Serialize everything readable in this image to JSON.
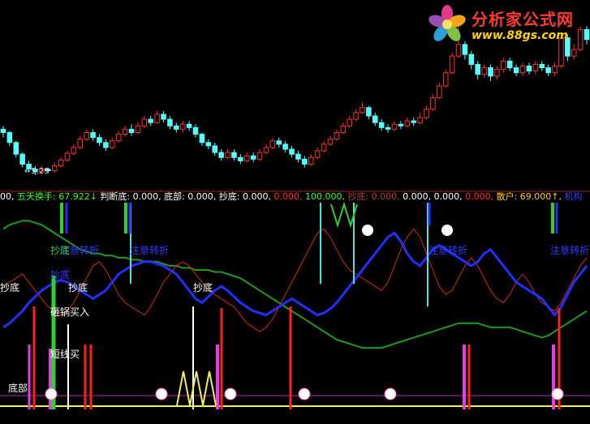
{
  "logo": {
    "title": "分析家公式网",
    "url": "www.88gs.com"
  },
  "price_marker": "←5.29",
  "status_bar": [
    {
      "text": "00,",
      "color": "#ffffff"
    },
    {
      "text": " 五天换手: 67.922↓",
      "color": "#33ff33"
    },
    {
      "text": " 判断底: 0.000,",
      "color": "#ffffff"
    },
    {
      "text": " 底部: 0.000,",
      "color": "#ffffff"
    },
    {
      "text": " 抄底: 0.000,",
      "color": "#ffffff"
    },
    {
      "text": " 0.000,",
      "color": "#ff3030"
    },
    {
      "text": " 100.000,",
      "color": "#33ff33"
    },
    {
      "text": " 抄底: 0.000,",
      "color": "#b04040"
    },
    {
      "text": " 0.000,",
      "color": "#ffffff"
    },
    {
      "text": " 0.000,",
      "color": "#ffffff"
    },
    {
      "text": " 0.000,",
      "color": "#ff3030"
    },
    {
      "text": " 散户: 69.000↑,",
      "color": "#ffd200"
    },
    {
      "text": " 机构",
      "color": "#3040ff"
    }
  ],
  "indicator_labels": [
    {
      "text": "抄底",
      "color": "white",
      "pos": "a"
    },
    {
      "text": "抄底",
      "color": "white",
      "pos": "b"
    },
    {
      "text": "抄底",
      "color": "white",
      "pos": "c"
    },
    {
      "text": "注意转折",
      "color": "blue",
      "pos": "d"
    },
    {
      "text": "注意转折",
      "color": "blue",
      "pos": "e"
    },
    {
      "text": "注意转折",
      "color": "blue",
      "pos": "f"
    },
    {
      "text": "注意转折",
      "color": "blue",
      "pos": "g"
    },
    {
      "text": "抄底",
      "color": "green",
      "pos": "h"
    },
    {
      "text": "抄底",
      "color": "blue",
      "pos": "i"
    },
    {
      "text": "砸锅买入",
      "color": "white",
      "pos": "j"
    },
    {
      "text": "短线买",
      "color": "white",
      "pos": "k"
    },
    {
      "text": "底部",
      "color": "white",
      "pos": "l"
    }
  ],
  "chart_data": {
    "type": "line",
    "candles": [
      [
        5.84,
        5.8,
        5.88,
        5.74
      ],
      [
        5.8,
        5.68,
        5.82,
        5.64
      ],
      [
        5.68,
        5.54,
        5.7,
        5.5
      ],
      [
        5.54,
        5.42,
        5.56,
        5.38
      ],
      [
        5.42,
        5.36,
        5.46,
        5.32
      ],
      [
        5.36,
        5.33,
        5.4,
        5.29
      ],
      [
        5.33,
        5.36,
        5.4,
        5.3
      ],
      [
        5.36,
        5.34,
        5.38,
        5.31
      ],
      [
        5.34,
        5.4,
        5.44,
        5.32
      ],
      [
        5.4,
        5.47,
        5.5,
        5.38
      ],
      [
        5.47,
        5.55,
        5.58,
        5.45
      ],
      [
        5.55,
        5.62,
        5.66,
        5.53
      ],
      [
        5.62,
        5.72,
        5.76,
        5.6
      ],
      [
        5.72,
        5.8,
        5.84,
        5.7
      ],
      [
        5.8,
        5.74,
        5.84,
        5.7
      ],
      [
        5.74,
        5.68,
        5.78,
        5.64
      ],
      [
        5.68,
        5.62,
        5.72,
        5.58
      ],
      [
        5.62,
        5.7,
        5.74,
        5.6
      ],
      [
        5.7,
        5.78,
        5.82,
        5.68
      ],
      [
        5.78,
        5.84,
        5.88,
        5.75
      ],
      [
        5.84,
        5.8,
        5.9,
        5.76
      ],
      [
        5.8,
        5.88,
        5.92,
        5.78
      ],
      [
        5.88,
        5.96,
        6.0,
        5.85
      ],
      [
        5.96,
        5.92,
        6.0,
        5.88
      ],
      [
        5.92,
        6.02,
        6.06,
        5.9
      ],
      [
        6.02,
        5.96,
        6.06,
        5.92
      ],
      [
        5.96,
        5.88,
        6.0,
        5.84
      ],
      [
        5.88,
        5.84,
        5.92,
        5.8
      ],
      [
        5.84,
        5.9,
        5.94,
        5.8
      ],
      [
        5.9,
        5.86,
        5.94,
        5.82
      ],
      [
        5.86,
        5.78,
        5.9,
        5.74
      ],
      [
        5.78,
        5.68,
        5.8,
        5.64
      ],
      [
        5.68,
        5.64,
        5.72,
        5.6
      ],
      [
        5.64,
        5.56,
        5.68,
        5.52
      ],
      [
        5.56,
        5.5,
        5.6,
        5.46
      ],
      [
        5.5,
        5.56,
        5.6,
        5.48
      ],
      [
        5.56,
        5.5,
        5.6,
        5.46
      ],
      [
        5.5,
        5.46,
        5.54,
        5.42
      ],
      [
        5.46,
        5.52,
        5.56,
        5.44
      ],
      [
        5.52,
        5.48,
        5.56,
        5.44
      ],
      [
        5.48,
        5.56,
        5.6,
        5.46
      ],
      [
        5.56,
        5.62,
        5.66,
        5.54
      ],
      [
        5.62,
        5.7,
        5.74,
        5.6
      ],
      [
        5.7,
        5.66,
        5.74,
        5.62
      ],
      [
        5.66,
        5.6,
        5.7,
        5.56
      ],
      [
        5.6,
        5.54,
        5.64,
        5.5
      ],
      [
        5.54,
        5.48,
        5.58,
        5.44
      ],
      [
        5.48,
        5.42,
        5.52,
        5.38
      ],
      [
        5.42,
        5.5,
        5.54,
        5.4
      ],
      [
        5.5,
        5.58,
        5.62,
        5.48
      ],
      [
        5.58,
        5.66,
        5.7,
        5.56
      ],
      [
        5.66,
        5.72,
        5.76,
        5.64
      ],
      [
        5.72,
        5.8,
        5.84,
        5.7
      ],
      [
        5.8,
        5.88,
        5.92,
        5.78
      ],
      [
        5.88,
        5.96,
        6.0,
        5.86
      ],
      [
        5.96,
        6.04,
        6.08,
        5.94
      ],
      [
        6.04,
        6.1,
        6.16,
        6.02
      ],
      [
        6.1,
        6.0,
        6.12,
        5.96
      ],
      [
        6.0,
        5.92,
        6.04,
        5.88
      ],
      [
        5.92,
        5.86,
        5.96,
        5.82
      ],
      [
        5.86,
        5.84,
        5.9,
        5.8
      ],
      [
        5.84,
        5.9,
        5.94,
        5.82
      ],
      [
        5.9,
        5.88,
        5.94,
        5.84
      ],
      [
        5.88,
        5.94,
        5.98,
        5.86
      ],
      [
        5.94,
        5.92,
        5.98,
        5.88
      ],
      [
        5.92,
        5.98,
        6.04,
        5.9
      ],
      [
        5.98,
        6.08,
        6.12,
        5.96
      ],
      [
        6.08,
        6.22,
        6.26,
        6.06
      ],
      [
        6.22,
        6.36,
        6.4,
        6.2
      ],
      [
        6.36,
        6.52,
        6.56,
        6.34
      ],
      [
        6.52,
        6.72,
        6.76,
        6.5
      ],
      [
        6.72,
        6.86,
        7.1,
        6.7
      ],
      [
        6.86,
        6.74,
        6.9,
        6.68
      ],
      [
        6.74,
        6.62,
        6.78,
        6.56
      ],
      [
        6.62,
        6.5,
        6.66,
        6.44
      ],
      [
        6.5,
        6.58,
        6.62,
        6.46
      ],
      [
        6.58,
        6.48,
        6.62,
        6.42
      ],
      [
        6.48,
        6.56,
        6.6,
        6.44
      ],
      [
        6.56,
        6.66,
        6.7,
        6.52
      ],
      [
        6.66,
        6.58,
        6.7,
        6.54
      ],
      [
        6.58,
        6.52,
        6.62,
        6.48
      ],
      [
        6.52,
        6.6,
        6.64,
        6.48
      ],
      [
        6.6,
        6.54,
        6.64,
        6.5
      ],
      [
        6.54,
        6.62,
        6.66,
        6.5
      ],
      [
        6.62,
        6.58,
        6.66,
        6.54
      ],
      [
        6.58,
        6.52,
        6.62,
        6.48
      ],
      [
        6.52,
        6.6,
        6.64,
        6.48
      ],
      [
        6.6,
        6.94,
        7.0,
        6.58
      ],
      [
        6.94,
        6.72,
        6.98,
        6.66
      ],
      [
        6.72,
        6.8,
        6.86,
        6.68
      ],
      [
        6.8,
        7.04,
        7.08,
        6.78
      ],
      [
        7.04,
        6.92,
        7.08,
        6.86
      ]
    ],
    "indicator": {
      "blue": [
        40,
        42,
        45,
        48,
        52,
        55,
        58,
        60,
        62,
        63,
        62,
        60,
        58,
        56,
        54,
        56,
        58,
        62,
        66,
        68,
        70,
        71,
        72,
        72,
        71,
        70,
        68,
        66,
        62,
        58,
        54,
        52,
        55,
        58,
        60,
        58,
        55,
        52,
        50,
        48,
        47,
        46,
        48,
        50,
        52,
        54,
        52,
        50,
        48,
        46,
        47,
        49,
        52,
        56,
        60,
        64,
        68,
        72,
        76,
        80,
        84,
        86,
        82,
        76,
        72,
        70,
        74,
        78,
        80,
        78,
        76,
        74,
        72,
        70,
        72,
        76,
        78,
        74,
        70,
        66,
        62,
        60,
        58,
        56,
        54,
        50,
        46,
        50,
        56,
        62,
        66,
        70
      ],
      "green": [
        88,
        90,
        91,
        92,
        92,
        91,
        90,
        88,
        86,
        84,
        82,
        80,
        78,
        77,
        76,
        76,
        75,
        75,
        74,
        74,
        73,
        73,
        72,
        72,
        72,
        71,
        70,
        70,
        69,
        69,
        68,
        68,
        68,
        67,
        67,
        66,
        65,
        64,
        62,
        60,
        58,
        56,
        54,
        52,
        50,
        48,
        46,
        44,
        42,
        40,
        38,
        36,
        34,
        33,
        32,
        31,
        30,
        30,
        30,
        30,
        31,
        32,
        33,
        34,
        35,
        36,
        37,
        38,
        39,
        40,
        41,
        42,
        42,
        42,
        42,
        41,
        40,
        40,
        40,
        40,
        39,
        38,
        37,
        36,
        35,
        36,
        38,
        40,
        42,
        44,
        46,
        48
      ],
      "red": [
        60,
        62,
        64,
        66,
        62,
        58,
        54,
        50,
        48,
        46,
        48,
        52,
        58,
        64,
        70,
        72,
        68,
        62,
        56,
        52,
        50,
        48,
        46,
        50,
        56,
        62,
        66,
        70,
        72,
        70,
        66,
        62,
        58,
        56,
        54,
        52,
        50,
        46,
        42,
        40,
        38,
        40,
        44,
        50,
        56,
        62,
        68,
        74,
        80,
        86,
        88,
        84,
        78,
        72,
        68,
        66,
        64,
        62,
        60,
        58,
        62,
        70,
        78,
        84,
        88,
        84,
        76,
        68,
        60,
        56,
        58,
        64,
        70,
        74,
        70,
        64,
        58,
        54,
        52,
        56,
        62,
        66,
        62,
        56,
        52,
        50,
        48,
        52,
        58,
        64,
        70,
        74
      ]
    }
  }
}
